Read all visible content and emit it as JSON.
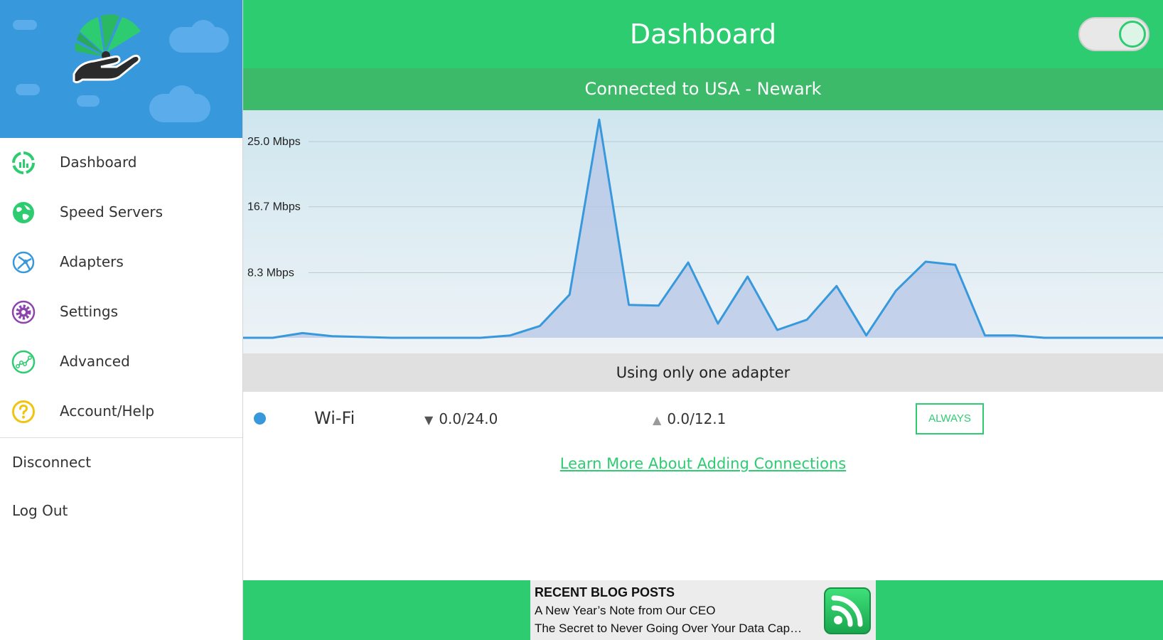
{
  "sidebar": {
    "items": [
      {
        "label": "Dashboard",
        "icon": "dashboard-icon",
        "color": "#2ecc71"
      },
      {
        "label": "Speed Servers",
        "icon": "globe-icon",
        "color": "#2ecc71"
      },
      {
        "label": "Adapters",
        "icon": "network-icon",
        "color": "#3898dc"
      },
      {
        "label": "Settings",
        "icon": "gear-icon",
        "color": "#8e44ad"
      },
      {
        "label": "Advanced",
        "icon": "graph-icon",
        "color": "#2ecc71"
      },
      {
        "label": "Account/Help",
        "icon": "help-icon",
        "color": "#f1c40f"
      }
    ],
    "disconnect_label": "Disconnect",
    "logout_label": "Log Out"
  },
  "header": {
    "title": "Dashboard",
    "toggle_on": true
  },
  "status": {
    "text": "Connected to USA - Newark"
  },
  "chart_data": {
    "type": "area",
    "yticks": [
      "25.0 Mbps",
      "16.7 Mbps",
      "8.3 Mbps"
    ],
    "ytick_values": [
      25.0,
      16.7,
      8.3
    ],
    "ylim": [
      0,
      29
    ],
    "x": [
      0,
      1,
      2,
      3,
      4,
      5,
      6,
      7,
      8,
      9,
      10,
      11,
      12,
      13,
      14,
      15,
      16,
      17,
      18,
      19,
      20,
      21,
      22,
      23,
      24,
      25,
      26,
      27,
      28,
      29,
      30,
      31
    ],
    "values": [
      0,
      0,
      0.6,
      0.2,
      0.1,
      0,
      0,
      0,
      0,
      0.3,
      1.5,
      5.5,
      27.8,
      4.2,
      4.1,
      9.6,
      1.8,
      7.8,
      1.0,
      2.3,
      6.6,
      0.3,
      6.0,
      9.7,
      9.3,
      0.3,
      0.3,
      0,
      0,
      0,
      0,
      0
    ],
    "colors": {
      "line": "#3898dc",
      "fill": "#b6c6e6",
      "bg_top": "#cfe6ef",
      "bg_bottom": "#eef3f7",
      "grid": "#b9c9d1"
    }
  },
  "adapters": {
    "banner": "Using only one adapter",
    "rows": [
      {
        "name": "Wi-Fi",
        "down": "0.0/24.0",
        "up": "0.0/12.1",
        "mode": "ALWAYS",
        "dot_color": "#3898dc"
      }
    ],
    "learn_more": "Learn More About Adding Connections"
  },
  "blog": {
    "title": "RECENT BLOG POSTS",
    "posts": [
      "A New Year’s Note from Our CEO",
      "The Secret to Never Going Over Your Data Cap…"
    ]
  }
}
